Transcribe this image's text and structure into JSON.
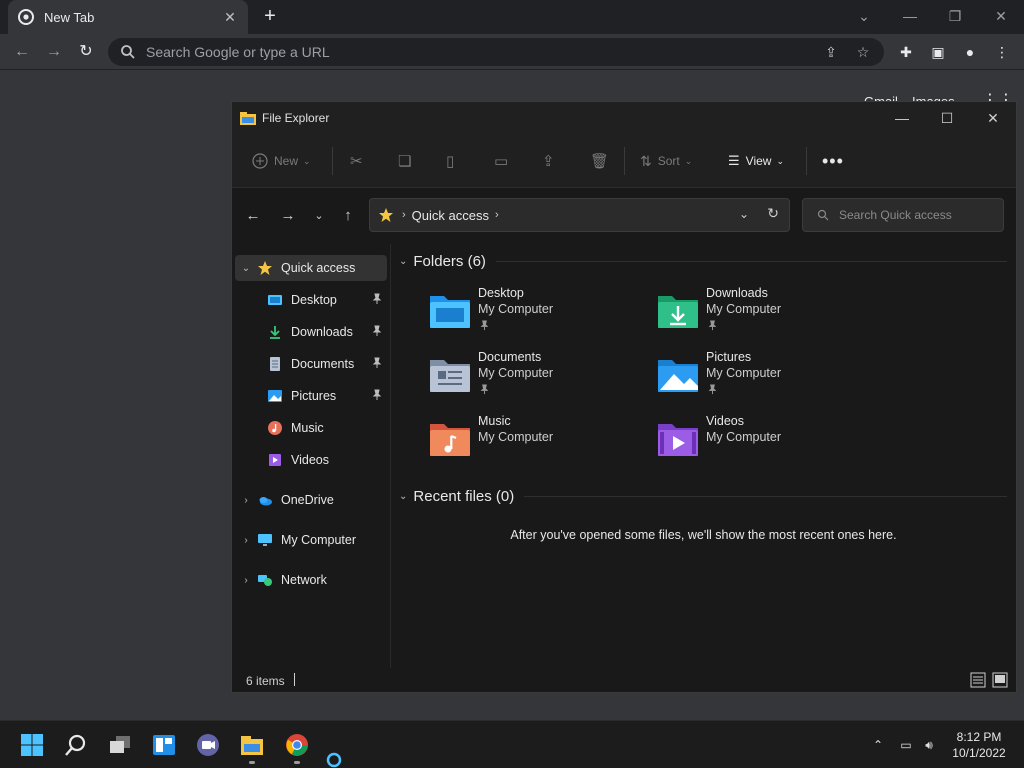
{
  "browser": {
    "tab_title": "New Tab",
    "omnibox_placeholder": "Search Google or type a URL",
    "ntp_links": [
      "Gmail",
      "Images"
    ]
  },
  "explorer": {
    "window_title": "File Explorer",
    "commands": {
      "new": "New",
      "sort": "Sort",
      "view": "View"
    },
    "address": {
      "crumb": "Quick access"
    },
    "search_placeholder": "Search Quick access",
    "nav": {
      "quick_access": "Quick access",
      "pinned": [
        "Desktop",
        "Downloads",
        "Documents",
        "Pictures"
      ],
      "unpinned": [
        "Music",
        "Videos"
      ],
      "onedrive": "OneDrive",
      "my_computer": "My Computer",
      "network": "Network"
    },
    "folders_heading": "Folders (6)",
    "folders": [
      {
        "name": "Desktop",
        "location": "My Computer",
        "pinned": true,
        "icon": "desktop-folder-icon"
      },
      {
        "name": "Downloads",
        "location": "My Computer",
        "pinned": true,
        "icon": "downloads-folder-icon"
      },
      {
        "name": "Documents",
        "location": "My Computer",
        "pinned": true,
        "icon": "documents-folder-icon"
      },
      {
        "name": "Pictures",
        "location": "My Computer",
        "pinned": true,
        "icon": "pictures-folder-icon"
      },
      {
        "name": "Music",
        "location": "My Computer",
        "pinned": false,
        "icon": "music-folder-icon"
      },
      {
        "name": "Videos",
        "location": "My Computer",
        "pinned": false,
        "icon": "videos-folder-icon"
      }
    ],
    "recent_heading": "Recent files (0)",
    "recent_message": "After you've opened some files, we'll show the most recent ones here.",
    "status_count": "6 items"
  },
  "taskbar": {
    "time": "8:12 PM",
    "date": "10/1/2022"
  },
  "colors": {
    "accent_blue": "#4cc2ff",
    "folder_yellow": "#f4c542"
  }
}
